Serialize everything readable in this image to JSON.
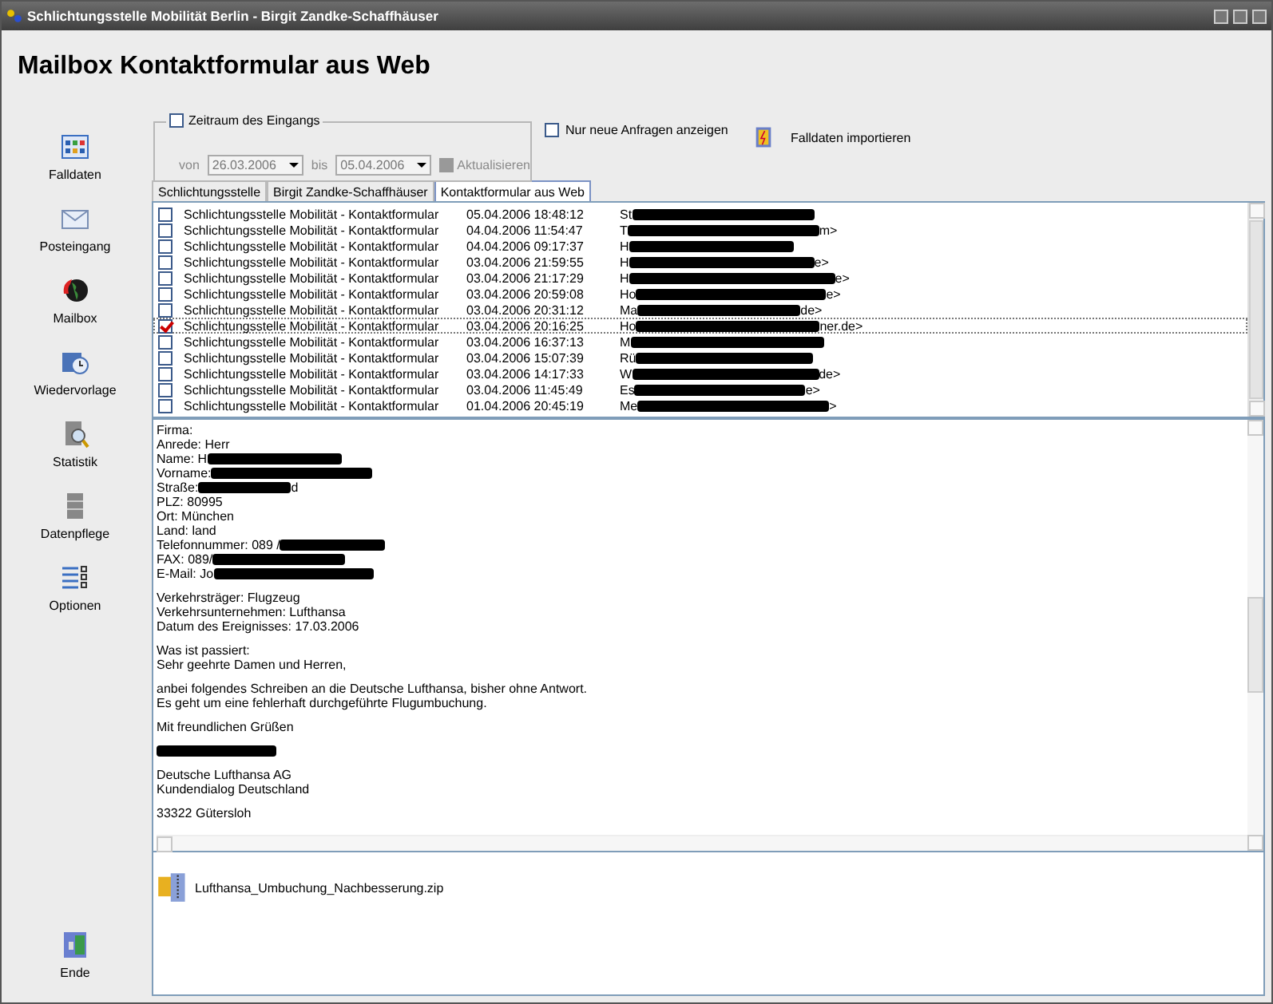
{
  "window": {
    "title": "Schlichtungsstelle Mobilität Berlin - Birgit Zandke-Schaffhäuser"
  },
  "heading": "Mailbox Kontaktformular aus Web",
  "sidebar": {
    "items": [
      {
        "label": "Falldaten",
        "kind": "grid"
      },
      {
        "label": "Posteingang",
        "kind": "envelope"
      },
      {
        "label": "Mailbox",
        "kind": "globe"
      },
      {
        "label": "Wiedervorlage",
        "kind": "clock"
      },
      {
        "label": "Statistik",
        "kind": "magnifier"
      },
      {
        "label": "Datenpflege",
        "kind": "cabinet"
      },
      {
        "label": "Optionen",
        "kind": "list"
      }
    ],
    "exit": {
      "label": "Ende"
    }
  },
  "filter": {
    "checkbox": {
      "label": "Zeitraum des Eingangs",
      "checked": false
    },
    "from_label": "von",
    "from": "26.03.2006",
    "to_label": "bis",
    "to": "05.04.2006",
    "refresh": {
      "label": "Aktualisieren",
      "disabled": true
    }
  },
  "only_new": {
    "label": "Nur neue Anfragen anzeigen",
    "checked": false
  },
  "import_button": {
    "label": "Falldaten importieren"
  },
  "tabs": [
    {
      "label": "Schlichtungsstelle",
      "selected": false
    },
    {
      "label": "Birgit Zandke-Schaffhäuser",
      "selected": false
    },
    {
      "label": "Kontaktformular aus Web",
      "selected": true
    }
  ],
  "messages": [
    {
      "checked": false,
      "selected": false,
      "subject": "Schlichtungsstelle Mobilität - Kontaktformular",
      "date": "05.04.2006 18:48:12",
      "sender": "St"
    },
    {
      "checked": false,
      "selected": false,
      "subject": "Schlichtungsstelle Mobilität - Kontaktformular",
      "date": "04.04.2006 11:54:47",
      "sender": "T",
      "sender_tail": "m>"
    },
    {
      "checked": false,
      "selected": false,
      "subject": "Schlichtungsstelle Mobilität - Kontaktformular",
      "date": "04.04.2006 09:17:37",
      "sender": "H"
    },
    {
      "checked": false,
      "selected": false,
      "subject": "Schlichtungsstelle Mobilität - Kontaktformular",
      "date": "03.04.2006 21:59:55",
      "sender": "H",
      "sender_tail": "e>"
    },
    {
      "checked": false,
      "selected": false,
      "subject": "Schlichtungsstelle Mobilität - Kontaktformular",
      "date": "03.04.2006 21:17:29",
      "sender": "H",
      "sender_tail": "e>"
    },
    {
      "checked": false,
      "selected": false,
      "subject": "Schlichtungsstelle Mobilität - Kontaktformular",
      "date": "03.04.2006 20:59:08",
      "sender": "Ho",
      "sender_tail": "e>"
    },
    {
      "checked": false,
      "selected": false,
      "subject": "Schlichtungsstelle Mobilität - Kontaktformular",
      "date": "03.04.2006 20:31:12",
      "sender": "Ma",
      "sender_tail": "de>"
    },
    {
      "checked": true,
      "selected": true,
      "subject": "Schlichtungsstelle Mobilität - Kontaktformular",
      "date": "03.04.2006 20:16:25",
      "sender": "Ho",
      "sender_tail": "ner.de>"
    },
    {
      "checked": false,
      "selected": false,
      "subject": "Schlichtungsstelle Mobilität - Kontaktformular",
      "date": "03.04.2006 16:37:13",
      "sender": "M"
    },
    {
      "checked": false,
      "selected": false,
      "subject": "Schlichtungsstelle Mobilität - Kontaktformular",
      "date": "03.04.2006 15:07:39",
      "sender": "Rü"
    },
    {
      "checked": false,
      "selected": false,
      "subject": "Schlichtungsstelle Mobilität - Kontaktformular",
      "date": "03.04.2006 14:17:33",
      "sender": "W",
      "sender_tail": "de>"
    },
    {
      "checked": false,
      "selected": false,
      "subject": "Schlichtungsstelle Mobilität - Kontaktformular",
      "date": "03.04.2006 11:45:49",
      "sender": "Es",
      "sender_tail": "e>"
    },
    {
      "checked": false,
      "selected": false,
      "subject": "Schlichtungsstelle Mobilität - Kontaktformular",
      "date": "01.04.2006 20:45:19",
      "sender": "Me",
      "sender_tail": ">"
    }
  ],
  "body": [
    [
      {
        "text": "Firma:"
      },
      {
        "text": "Anrede: Herr"
      },
      {
        "text": "Name: H",
        "redacted": true
      },
      {
        "text": "Vorname: ",
        "redacted": true
      },
      {
        "text": "Straße: ",
        "redacted": true,
        "tail": "d"
      },
      {
        "text": "PLZ: 80995"
      },
      {
        "text": "Ort: München"
      },
      {
        "text": "Land: land"
      },
      {
        "text": "Telefonnummer: 089 / ",
        "redacted": true
      },
      {
        "text": "FAX: 089/",
        "redacted": true
      },
      {
        "text": "E-Mail: Jo",
        "redacted": true
      }
    ],
    [
      {
        "text": "Verkehrsträger: Flugzeug"
      },
      {
        "text": "Verkehrsunternehmen: Lufthansa"
      },
      {
        "text": "Datum des Ereignisses: 17.03.2006"
      }
    ],
    [
      {
        "text": "Was ist passiert:"
      },
      {
        "text": "Sehr geehrte Damen und Herren,"
      }
    ],
    [
      {
        "text": "anbei folgendes Schreiben an die Deutsche Lufthansa, bisher ohne Antwort."
      },
      {
        "text": "Es geht um eine fehlerhaft durchgeführte Flugumbuchung."
      }
    ],
    [
      {
        "text": "Mit freundlichen Grüßen"
      }
    ],
    [
      {
        "redacted": true
      }
    ],
    [
      {
        "text": "Deutsche Lufthansa AG"
      },
      {
        "text": "Kundendialog Deutschland"
      }
    ],
    [
      {
        "text": "33322 Gütersloh"
      }
    ]
  ],
  "attachments": [
    {
      "name": "Lufthansa_Umbuchung_Nachbesserung.zip"
    }
  ]
}
